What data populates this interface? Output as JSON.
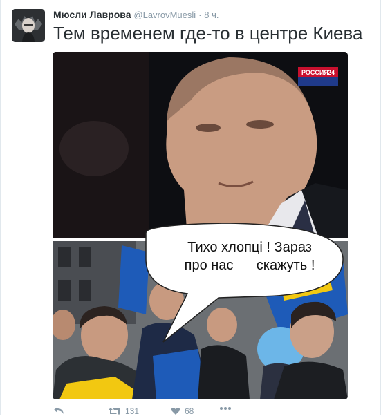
{
  "tweet": {
    "author_name": "Мюсли Лаврова",
    "author_handle": "@LavrovMuesli",
    "separator": "·",
    "time": "8 ч.",
    "text": "Тем временем где-то в центре Киева"
  },
  "image": {
    "channel_logo": "РОССИЯ",
    "channel_number": "24",
    "bubble_line1": "Тихо хлопці ! Зараз",
    "bubble_line2": "про нас      скажуть !"
  },
  "actions": {
    "reply_icon": "reply-icon",
    "retweet_icon": "retweet-icon",
    "retweet_count": "131",
    "like_icon": "heart-icon",
    "like_count": "68",
    "more_icon": "more-icon"
  },
  "colors": {
    "name": "#292f33",
    "meta": "#8899a6",
    "border": "#e1e8ed"
  }
}
